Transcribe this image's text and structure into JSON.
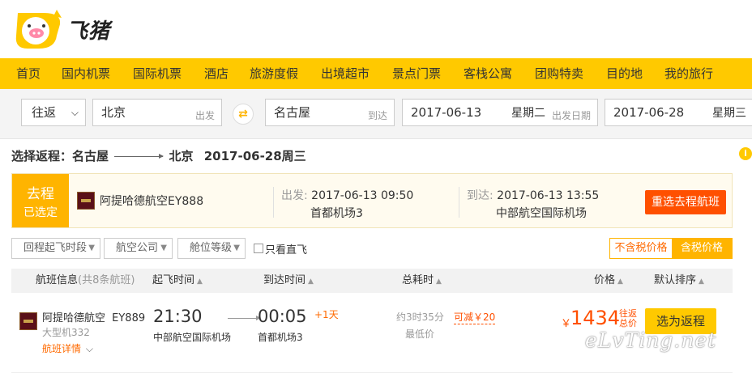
{
  "header": {
    "brand": "飞猪"
  },
  "nav": [
    "首页",
    "国内机票",
    "国际机票",
    "酒店",
    "旅游度假",
    "出境超市",
    "景点门票",
    "客栈公寓",
    "团购特卖",
    "目的地",
    "我的旅行"
  ],
  "search": {
    "trip_type": "往返",
    "from_city": "北京",
    "from_tag": "出发",
    "to_city": "名古屋",
    "to_tag": "到达",
    "depart_date": "2017-06-13",
    "depart_weekday": "星期二",
    "depart_tag": "出发日期",
    "return_date": "2017-06-28",
    "return_weekday": "星期三"
  },
  "route": {
    "label": "选择返程：名古屋",
    "dest": "北京",
    "date": "2017-06-28周三"
  },
  "outbound": {
    "tag_line1": "去程",
    "tag_line2": "已选定",
    "airline": "阿提哈德航空EY888",
    "depart_label": "出发:",
    "depart_time": "2017-06-13 09:50",
    "depart_airport": "首都机场3",
    "arrive_label": "到达:",
    "arrive_time": "2017-06-13 13:55",
    "arrive_airport": "中部航空国际机场",
    "reselect": "重选去程航班"
  },
  "filters": {
    "time": "回程起飞时段",
    "airline": "航空公司",
    "cabin": "舱位等级",
    "direct": "只看直飞",
    "excl_tax": "不含税价格",
    "incl_tax": "含税价格"
  },
  "table": {
    "col_flight": "航班信息",
    "col_flight_count": "(共8条航班)",
    "col_depart": "起飞时间",
    "col_arrive": "到达时间",
    "col_duration": "总耗时",
    "col_price": "价格",
    "col_sort": "默认排序"
  },
  "flight": {
    "airline": "阿提哈德航空",
    "code": "EY889",
    "plane": "大型机332",
    "detail": "航班详情",
    "depart_time": "21:30",
    "depart_airport": "中部航空国际机场",
    "arrive_time": "00:05",
    "plus_day": "+1天",
    "arrive_airport": "首都机场3",
    "duration": "约3时35分",
    "lowest": "最低价",
    "discount": "可减￥20",
    "currency": "￥",
    "price": "1434",
    "incl_tax_note": "往返总价",
    "select": "选为返程"
  },
  "watermark": "eLvTing.net",
  "colors": {
    "brand_yellow": "#ffc900",
    "accent_orange": "#ff5000",
    "tag_orange": "#ffb400"
  }
}
